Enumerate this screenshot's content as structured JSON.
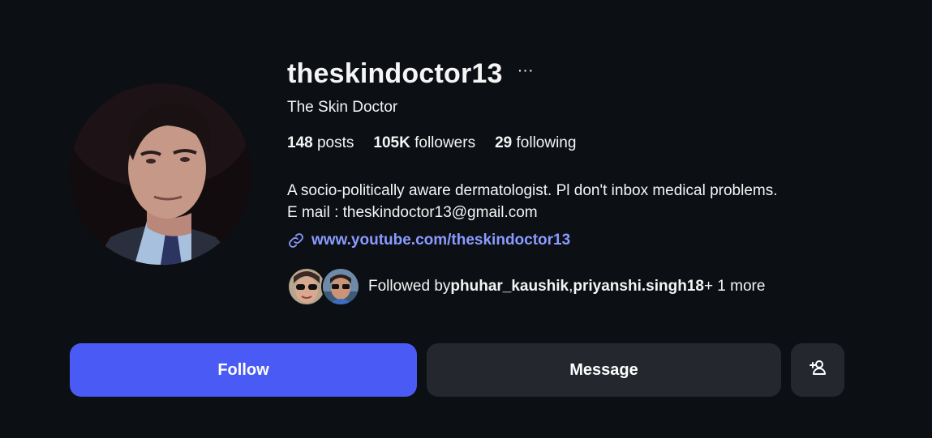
{
  "profile": {
    "username": "theskindoctor13",
    "more_icon": "more-options-icon",
    "full_name": "The Skin Doctor",
    "stats": {
      "posts_count": "148",
      "posts_label": " posts",
      "followers_count": "105K",
      "followers_label": " followers",
      "following_count": "29",
      "following_label": " following"
    },
    "bio_line1": "A socio-politically aware dermatologist. Pl don't inbox medical problems.",
    "bio_line2": "E mail : theskindoctor13@gmail.com",
    "link_icon": "link-icon",
    "link_text": "www.youtube.com/theskindoctor13",
    "followed_by": {
      "prefix": "Followed by ",
      "user1": "phuhar_kaushik",
      "separator": ", ",
      "user2": "priyanshi.singh18",
      "suffix": " + 1 more"
    }
  },
  "actions": {
    "follow_label": "Follow",
    "message_label": "Message",
    "add_user_icon": "add-user-icon"
  },
  "colors": {
    "background": "#0c0f14",
    "follow_button": "#4a5bf5",
    "secondary_button": "#24272d",
    "link": "#8a9bff",
    "text": "#f5f5f5"
  }
}
